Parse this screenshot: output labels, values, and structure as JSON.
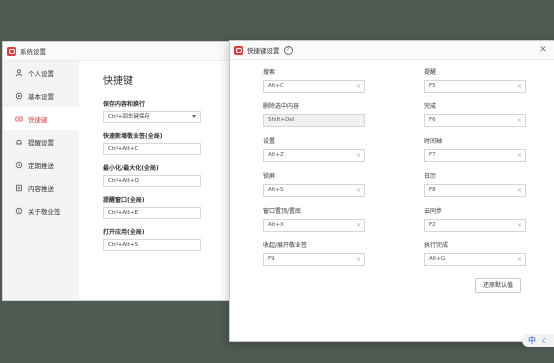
{
  "back_window": {
    "title": "系统设置",
    "sidebar": [
      {
        "label": "个人设置",
        "icon": "user-icon"
      },
      {
        "label": "基本设置",
        "icon": "settings-icon"
      },
      {
        "label": "快捷键",
        "icon": "keyboard-icon",
        "active": true
      },
      {
        "label": "提醒设置",
        "icon": "bell-icon"
      },
      {
        "label": "定期推送",
        "icon": "clock-icon"
      },
      {
        "label": "内容推送",
        "icon": "document-icon"
      },
      {
        "label": "关于敬业签",
        "icon": "info-icon"
      }
    ],
    "heading": "快捷键",
    "shortcuts": [
      {
        "label": "保存内容和换行",
        "value": "Ctrl+回车键保存"
      },
      {
        "label": "快速新增敬业签(全局)",
        "value": "Ctrl+Alt+C"
      },
      {
        "label": "最小化/最大化(全局)",
        "value": "Ctrl+Alt+Q"
      },
      {
        "label": "提醒窗口(全局)",
        "value": "Ctrl+Alt+E"
      },
      {
        "label": "打开应用(全局)",
        "value": "Ctrl+Alt+S"
      }
    ]
  },
  "front_window": {
    "title": "快捷键设置",
    "help_icon_text": "?",
    "close_symbol": "✕",
    "left_fields": [
      {
        "label": "搜索",
        "value": "Alt+C"
      },
      {
        "label": "删除选中内容",
        "value": "Shift+Del"
      },
      {
        "label": "设置",
        "value": "Alt+Z"
      },
      {
        "label": "锁屏",
        "value": "Alt+S"
      },
      {
        "label": "窗口置顶/置底",
        "value": "Alt+X"
      },
      {
        "label": "收起/展开敬业签",
        "value": "F9"
      }
    ],
    "right_fields": [
      {
        "label": "提醒",
        "value": "F5"
      },
      {
        "label": "完成",
        "value": "F6"
      },
      {
        "label": "时间轴",
        "value": "F7"
      },
      {
        "label": "日历",
        "value": "F8"
      },
      {
        "label": "云同步",
        "value": "F2"
      },
      {
        "label": "执行完成",
        "value": "Alt+G"
      }
    ],
    "clear_symbol": "×",
    "reset_label": "还原默认值"
  },
  "tray": {
    "ime": "中",
    "moon": "☾"
  },
  "colors": {
    "accent": "#e23b3b",
    "desktop": "#4f5a52"
  }
}
